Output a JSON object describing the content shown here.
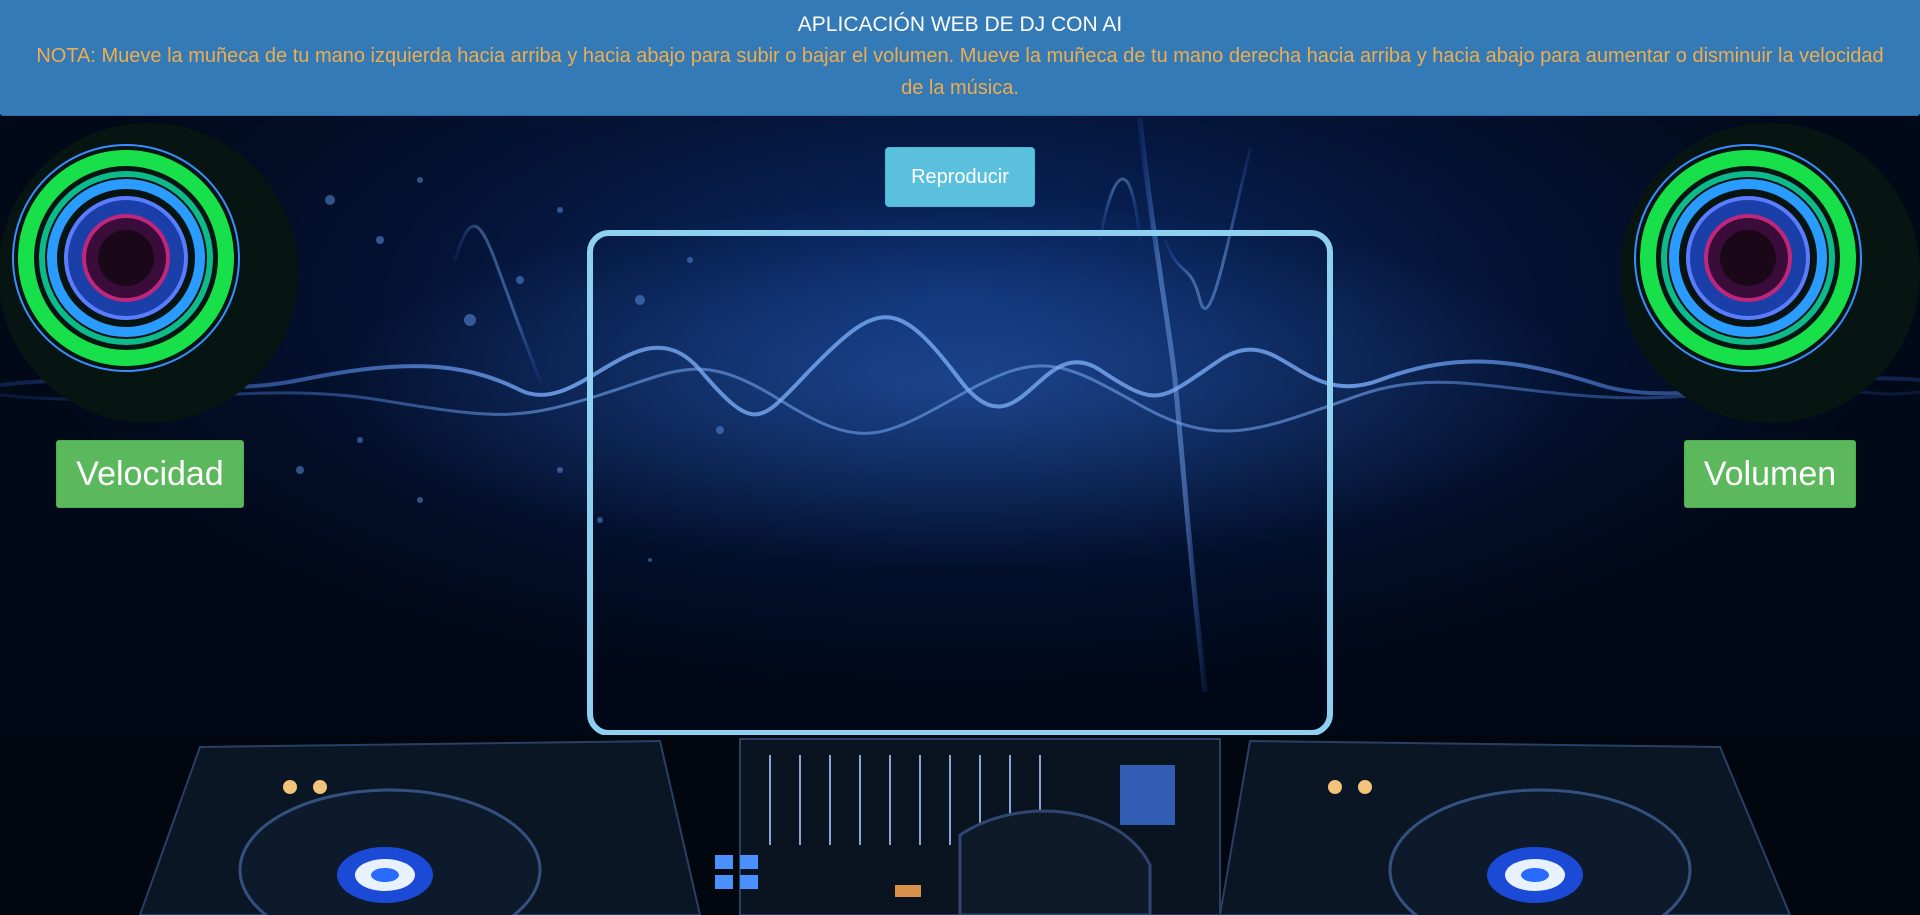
{
  "header": {
    "title": "APLICACIÓN WEB DE DJ CON AI",
    "note": "NOTA: Mueve la muñeca de tu mano izquierda hacia arriba y hacia abajo para subir o bajar el volumen. Mueve la muñeca de tu mano derecha hacia arriba y hacia abajo para aumentar o disminuir la velocidad de la música."
  },
  "controls": {
    "play_label": "Reproducir"
  },
  "badges": {
    "speed_label": "Velocidad",
    "volume_label": "Volumen"
  },
  "icons": {
    "left_speaker": "speaker-icon",
    "right_speaker": "speaker-icon",
    "dj_deck": "dj-controller-image"
  },
  "colors": {
    "header_bg": "#337ab7",
    "note_text": "#f0ad4e",
    "play_button": "#5bc0de",
    "badge": "#5cb85c",
    "frame_border": "#8ed0f0"
  }
}
